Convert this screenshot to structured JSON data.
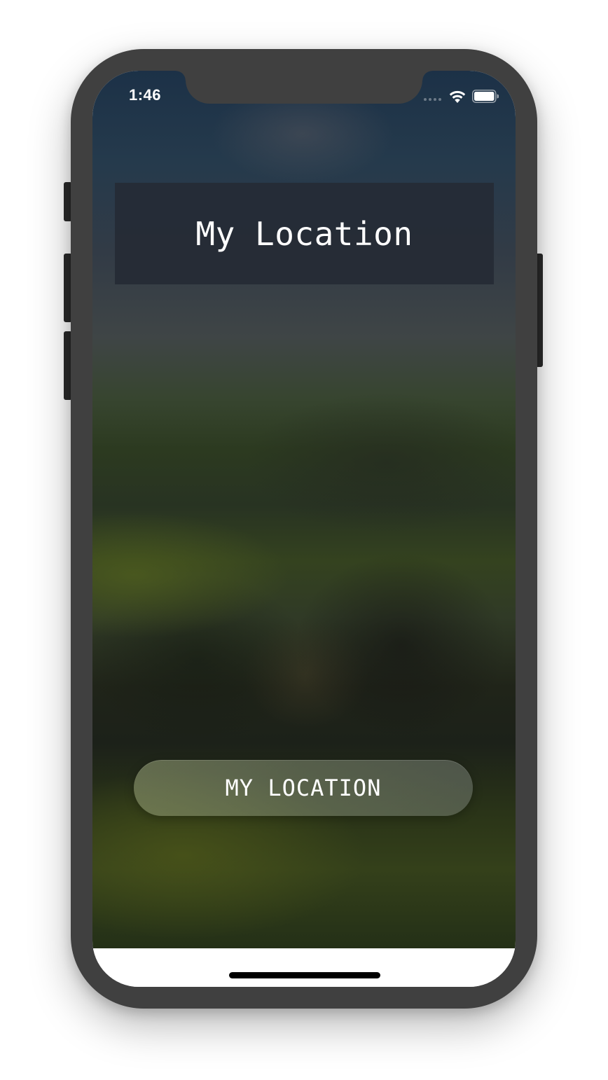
{
  "status_bar": {
    "time": "1:46",
    "icons": [
      "cellular-signal-icon",
      "wifi-icon",
      "battery-icon"
    ]
  },
  "header": {
    "title": "My Location"
  },
  "main": {
    "location_button_label": "MY LOCATION"
  },
  "colors": {
    "device_frame": "#404040",
    "title_background": "#242a34",
    "text": "#ffffff",
    "home_indicator": "#000000"
  }
}
